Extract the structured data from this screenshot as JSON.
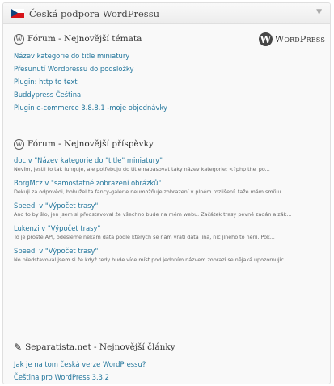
{
  "widget": {
    "title": "Česká podpora WordPressu",
    "toggle_icon": "triangle-down-icon"
  },
  "topics": {
    "title": "Fórum - Nejnovější témata",
    "logo_text": "WordPress",
    "items": [
      "Název kategorie do title miniatury",
      "Přesunutí Wordpressu do podsložky",
      "Plugin: http to text",
      "Buddypress Čeština",
      "Plugin e-commerce 3.8.8.1 -moje objednávky"
    ]
  },
  "posts": {
    "title": "Fórum - Nejnovější příspěvky",
    "items": [
      {
        "title": "doc v \"Název kategorie do \"title\" miniatury\"",
        "excerpt": "Nevím, jestli to tak funguje, ale potřebuju do title napasovat taky název kategorie: <?php the_po..."
      },
      {
        "title": "BorgMcz v \"samostatné zobrazení obrázků\"",
        "excerpt": "Dekuji za odpovědi, bohužel ta fancy-galerie neumožňuje zobrazení v plném rozlišení, tažе mám smůlu..."
      },
      {
        "title": "Speedi v \"Výpočet trasy\"",
        "excerpt": "Ano to by šlo, jen jsem si představoval že všechno bude na mém webu. Začátek trasy pevně zadán a zák..."
      },
      {
        "title": "Lukenzi v \"Výpočet trasy\"",
        "excerpt": "To je prostě API, odešleme někam data podle kterých se nám vrátí data jiná, nic jiného to není. Pok..."
      },
      {
        "title": "Speedi v \"Výpočet trasy\"",
        "excerpt": "No představoval jsem si že když tedy bude více míst pod jednním názvem zobrazí se nějaká upozornujíc..."
      }
    ]
  },
  "articles": {
    "title": "Separatista.net - Nejnovější články",
    "items": [
      "Jak je na tom česká verze WordPressu?",
      "Čeština pro WordPress 3.3.2"
    ]
  }
}
